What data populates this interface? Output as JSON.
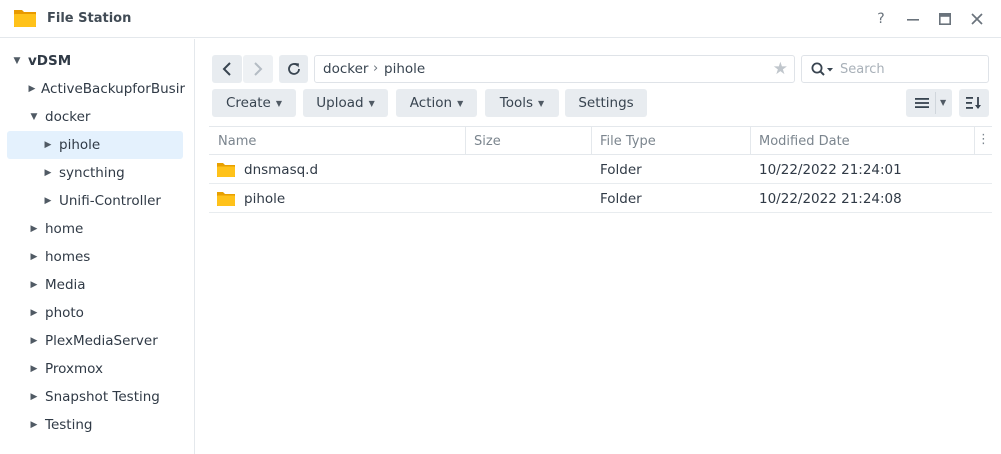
{
  "window": {
    "title": "File Station",
    "help_label": "?",
    "colors": {
      "accent": "#2580d8",
      "folder": "#f5b400",
      "selection": "#e4f1fd"
    }
  },
  "sidebar": {
    "root": "vDSM",
    "items": [
      {
        "label": "ActiveBackupforBusir"
      },
      {
        "label": "docker"
      },
      {
        "label": "pihole"
      },
      {
        "label": "syncthing"
      },
      {
        "label": "Unifi-Controller"
      },
      {
        "label": "home"
      },
      {
        "label": "homes"
      },
      {
        "label": "Media"
      },
      {
        "label": "photo"
      },
      {
        "label": "PlexMediaServer"
      },
      {
        "label": "Proxmox"
      },
      {
        "label": "Snapshot Testing"
      },
      {
        "label": "Testing"
      }
    ]
  },
  "toolbar": {
    "path": [
      "docker",
      "pihole"
    ],
    "search_placeholder": "Search",
    "create_label": "Create",
    "upload_label": "Upload",
    "action_label": "Action",
    "tools_label": "Tools",
    "settings_label": "Settings"
  },
  "file_list": {
    "columns": [
      "Name",
      "Size",
      "File Type",
      "Modified Date"
    ],
    "rows": [
      {
        "name": "dnsmasq.d",
        "size": "",
        "type": "Folder",
        "modified": "10/22/2022 21:24:01"
      },
      {
        "name": "pihole",
        "size": "",
        "type": "Folder",
        "modified": "10/22/2022 21:24:08"
      }
    ]
  }
}
